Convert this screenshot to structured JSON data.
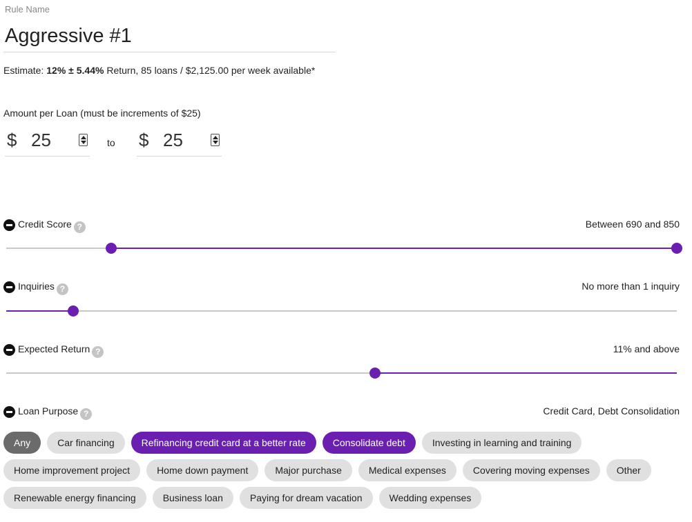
{
  "rule": {
    "label": "Rule Name",
    "name": "Aggressive #1"
  },
  "estimate": {
    "prefix": "Estimate:",
    "bold": "12% ± 5.44%",
    "suffix": "Return, 85 loans / $2,125.00 per week available*"
  },
  "amount": {
    "label": "Amount per Loan (must be increments of $25)",
    "currency": "$",
    "min": "25",
    "max": "25",
    "to_label": "to"
  },
  "filters": {
    "credit_score": {
      "title": "Credit Score",
      "value": "Between 690 and 850",
      "range": [
        0.157,
        1.0
      ]
    },
    "inquiries": {
      "title": "Inquiries",
      "value": "No more than 1 inquiry",
      "level": 0.1
    },
    "expected_return": {
      "title": "Expected Return",
      "value": "11% and above",
      "level": 0.55
    },
    "loan_purpose": {
      "title": "Loan Purpose",
      "value": "Credit Card, Debt Consolidation"
    }
  },
  "help_glyph": "?",
  "icons": {
    "remove": "minus-circle-icon",
    "help": "question-circle-icon"
  },
  "colors": {
    "accent": "#6a1fb0",
    "chip": "#e0e0e0",
    "any_chip": "#6b6b6b"
  },
  "purposes": [
    {
      "label": "Any",
      "state": "any"
    },
    {
      "label": "Car financing",
      "state": "off"
    },
    {
      "label": "Refinancing credit card at a better rate",
      "state": "on"
    },
    {
      "label": "Consolidate debt",
      "state": "on"
    },
    {
      "label": "Investing in learning and training",
      "state": "off"
    },
    {
      "label": "Home improvement project",
      "state": "off"
    },
    {
      "label": "Home down payment",
      "state": "off"
    },
    {
      "label": "Major purchase",
      "state": "off"
    },
    {
      "label": "Medical expenses",
      "state": "off"
    },
    {
      "label": "Covering moving expenses",
      "state": "off"
    },
    {
      "label": "Other",
      "state": "off"
    },
    {
      "label": "Renewable energy financing",
      "state": "off"
    },
    {
      "label": "Business loan",
      "state": "off"
    },
    {
      "label": "Paying for dream vacation",
      "state": "off"
    },
    {
      "label": "Wedding expenses",
      "state": "off"
    }
  ]
}
